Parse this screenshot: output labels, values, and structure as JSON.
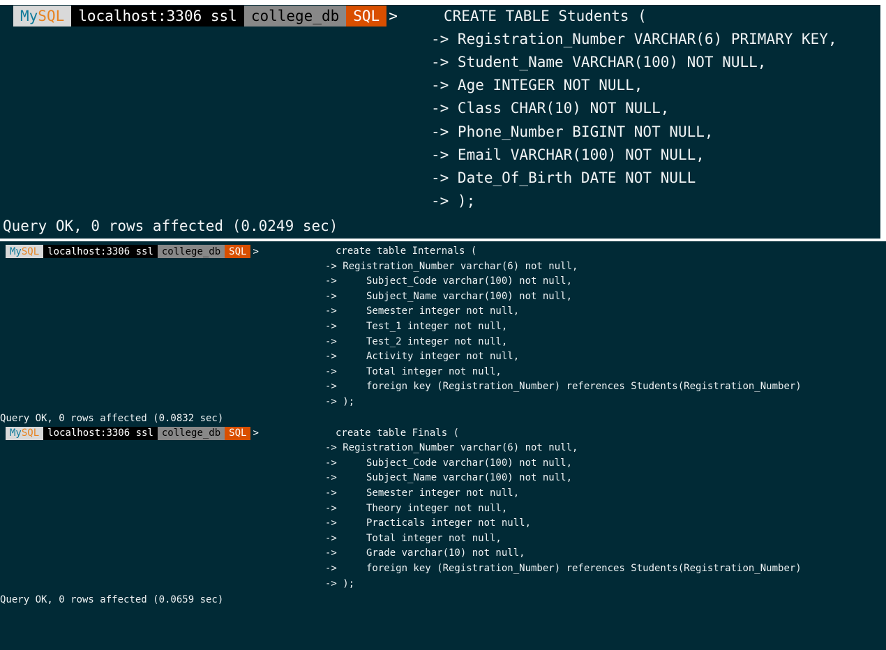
{
  "prompt": {
    "my": "My",
    "sql": "SQL",
    "host": "localhost:3306 ssl",
    "db": "college_db",
    "mode": "SQL",
    "arrow": ">"
  },
  "statements": [
    {
      "lines": [
        "CREATE TABLE Students (",
        "-> Registration_Number VARCHAR(6) PRIMARY KEY,",
        "-> Student_Name VARCHAR(100) NOT NULL,",
        "-> Age INTEGER NOT NULL,",
        "-> Class CHAR(10) NOT NULL,",
        "-> Phone_Number BIGINT NOT NULL,",
        "-> Email VARCHAR(100) NOT NULL,",
        "-> Date_Of_Birth DATE NOT NULL",
        "-> );"
      ],
      "result": "Query OK, 0 rows affected (0.0249 sec)"
    },
    {
      "lines": [
        "create table Internals (",
        "-> Registration_Number varchar(6) not null,",
        "->     Subject_Code varchar(100) not null,",
        "->     Subject_Name varchar(100) not null,",
        "->     Semester integer not null,",
        "->     Test_1 integer not null,",
        "->     Test_2 integer not null,",
        "->     Activity integer not null,",
        "->     Total integer not null,",
        "->     foreign key (Registration_Number) references Students(Registration_Number)",
        "-> );"
      ],
      "result": "Query OK, 0 rows affected (0.0832 sec)"
    },
    {
      "lines": [
        "create table Finals (",
        "-> Registration_Number varchar(6) not null,",
        "->     Subject_Code varchar(100) not null,",
        "->     Subject_Name varchar(100) not null,",
        "->     Semester integer not null,",
        "->     Theory integer not null,",
        "->     Practicals integer not null,",
        "->     Total integer not null,",
        "->     Grade varchar(10) not null,",
        "->     foreign key (Registration_Number) references Students(Registration_Number)",
        "-> );"
      ],
      "result": "Query OK, 0 rows affected (0.0659 sec)"
    }
  ],
  "colors": {
    "background": "#012a36",
    "mysql_segment": "#d9d9d9",
    "host_segment": "#000000",
    "db_segment": "#888888",
    "mode_segment": "#d94f00"
  }
}
